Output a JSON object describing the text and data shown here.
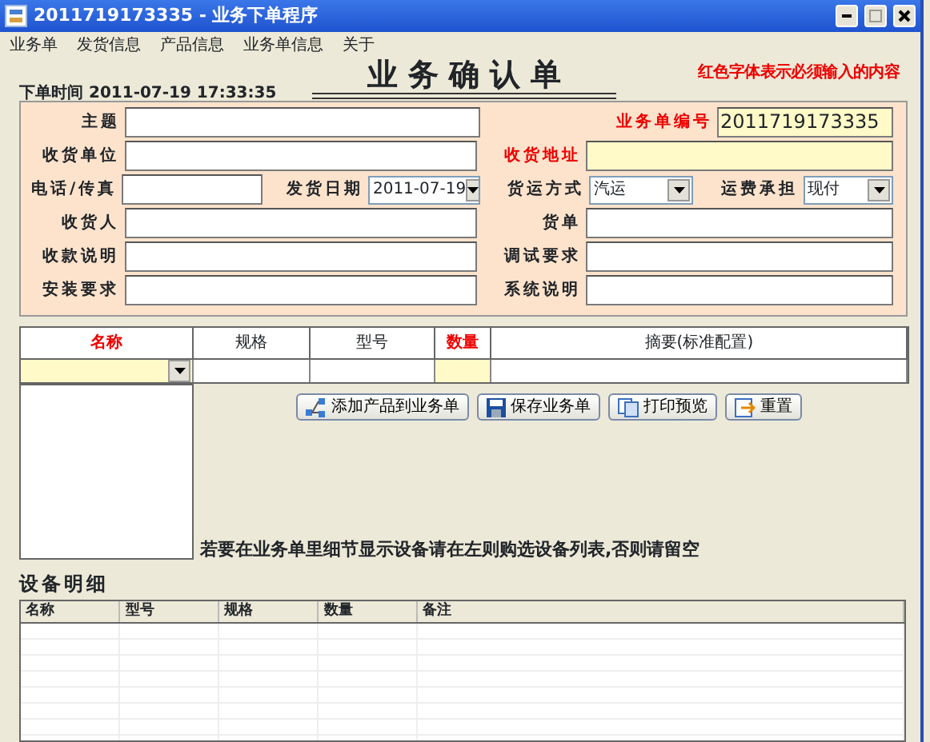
{
  "window": {
    "title": "2011719173335 - 业务下单程序"
  },
  "menu": [
    "业务单",
    "发货信息",
    "产品信息",
    "业务单信息",
    "关于"
  ],
  "header": {
    "title": "业 务 确 认 单",
    "time_label": "下单时间",
    "time": "2011-07-19 17:33:35",
    "note": "红色字体表示必须输入的内容"
  },
  "form_rows": [
    [
      {
        "label": "主题",
        "kind": "text",
        "required": false
      },
      {
        "label": "业务单编号",
        "kind": "text",
        "required": true,
        "value": "2011719173335"
      }
    ],
    [
      {
        "label": "收货单位",
        "kind": "text",
        "required": false
      },
      {
        "label": "收货地址",
        "kind": "text",
        "required": true
      }
    ],
    [
      {
        "label": "电话/传真",
        "kind": "text",
        "required": false
      },
      {
        "label": "发货日期",
        "kind": "select",
        "required": false,
        "value": "2011-07-19"
      },
      {
        "label": "货运方式",
        "kind": "select",
        "required": false,
        "value": "汽运"
      },
      {
        "label": "运费承担",
        "kind": "select",
        "required": false,
        "value": "现付"
      }
    ],
    [
      {
        "label": "收货人",
        "kind": "text",
        "required": false
      },
      {
        "label": "货单",
        "kind": "text",
        "required": false
      }
    ],
    [
      {
        "label": "收款说明",
        "kind": "text",
        "required": false
      },
      {
        "label": "调试要求",
        "kind": "text",
        "required": false
      }
    ],
    [
      {
        "label": "安装要求",
        "kind": "text",
        "required": false
      },
      {
        "label": "系统说明",
        "kind": "text",
        "required": false
      }
    ]
  ],
  "product_columns": [
    {
      "label": "名称",
      "required": true,
      "kind": "select"
    },
    {
      "label": "规格",
      "required": false,
      "kind": "text"
    },
    {
      "label": "型号",
      "required": false,
      "kind": "text"
    },
    {
      "label": "数量",
      "required": true,
      "kind": "text"
    },
    {
      "label": "摘要(标准配置)",
      "required": false,
      "kind": "text"
    }
  ],
  "buttons": [
    {
      "label": "添加产品到业务单",
      "kind": "add"
    },
    {
      "label": "保存业务单",
      "kind": "save"
    },
    {
      "label": "打印预览",
      "kind": "preview"
    },
    {
      "label": "重置",
      "kind": "reset"
    }
  ],
  "hint": "若要在业务单里细节显示设备请在左则购选设备列表,否则请留空",
  "details": {
    "title": "设备明细",
    "columns": [
      "名称",
      "型号",
      "规格",
      "数量",
      "备注"
    ]
  }
}
